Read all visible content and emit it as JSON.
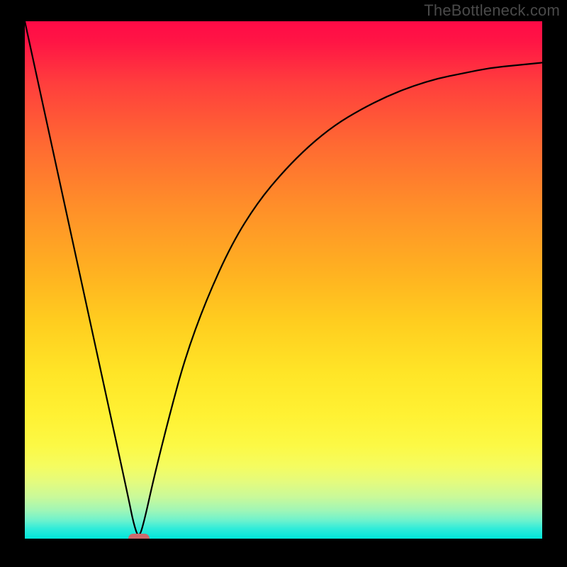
{
  "watermark": "TheBottleneck.com",
  "colors": {
    "frame_bg": "#000000",
    "curve": "#000000",
    "marker": "#cc6b6d",
    "watermark": "#4a4a4a"
  },
  "chart_data": {
    "type": "line",
    "title": "",
    "xlabel": "",
    "ylabel": "",
    "xlim": [
      0,
      100
    ],
    "ylim": [
      0,
      100
    ],
    "grid": false,
    "series": [
      {
        "name": "bottleneck-curve",
        "x": [
          0,
          5,
          10,
          15,
          20,
          21,
          22,
          23,
          25,
          28,
          31,
          35,
          40,
          45,
          50,
          55,
          60,
          65,
          70,
          75,
          80,
          85,
          90,
          95,
          100
        ],
        "y": [
          100,
          77,
          54,
          31,
          8,
          3,
          0,
          3,
          12,
          24,
          35,
          46,
          57,
          65,
          71,
          76,
          80,
          83,
          85.5,
          87.5,
          89,
          90,
          91,
          91.5,
          92
        ]
      }
    ],
    "minimum_marker": {
      "x": 22,
      "y": 0
    },
    "gradient_stops": [
      {
        "pos": 0.0,
        "color": "#ff0a46"
      },
      {
        "pos": 0.24,
        "color": "#ff6a32"
      },
      {
        "pos": 0.48,
        "color": "#ffb021"
      },
      {
        "pos": 0.68,
        "color": "#ffe527"
      },
      {
        "pos": 0.86,
        "color": "#f5fc60"
      },
      {
        "pos": 0.96,
        "color": "#6df2cd"
      },
      {
        "pos": 1.0,
        "color": "#00e7da"
      }
    ]
  }
}
